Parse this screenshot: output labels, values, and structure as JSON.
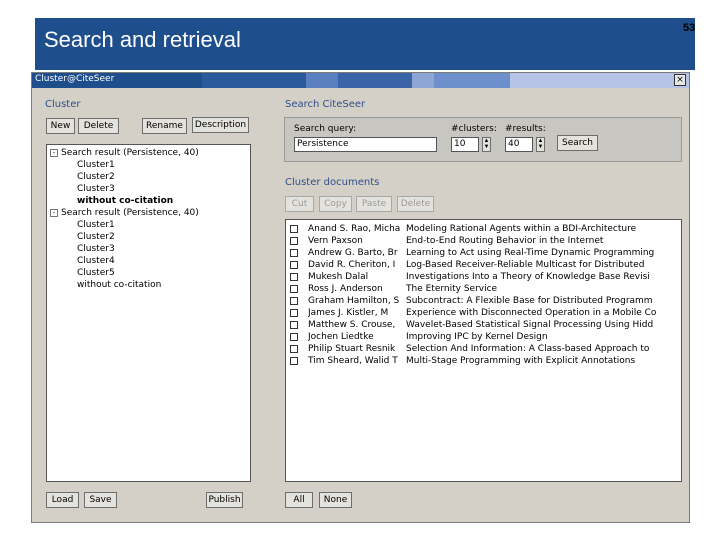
{
  "slide": {
    "title": "Search and retrieval",
    "number": "53"
  },
  "window": {
    "title": "Cluster@CiteSeer",
    "close_label": "×",
    "titlebar_colors": [
      "#1f4e8c",
      "#2a5a9c",
      "#5a7fbf",
      "#3b64a8",
      "#8da6d4",
      "#6d8fcc",
      "#b4c3e6"
    ]
  },
  "cluster_panel": {
    "title": "Cluster",
    "buttons": {
      "new": "New",
      "delete": "Delete",
      "rename": "Rename",
      "description": "Description"
    },
    "tree": [
      {
        "level": 0,
        "toggle": "-",
        "label": "Search result (Persistence, 40)"
      },
      {
        "level": 1,
        "label": "Cluster1"
      },
      {
        "level": 1,
        "label": "Cluster2"
      },
      {
        "level": 1,
        "label": "Cluster3"
      },
      {
        "level": 1,
        "label": "without co-citation",
        "bold": true
      },
      {
        "level": 0,
        "toggle": "-",
        "label": "Search result (Persistence, 40)"
      },
      {
        "level": 1,
        "label": "Cluster1"
      },
      {
        "level": 1,
        "label": "Cluster2"
      },
      {
        "level": 1,
        "label": "Cluster3"
      },
      {
        "level": 1,
        "label": "Cluster4"
      },
      {
        "level": 1,
        "label": "Cluster5"
      },
      {
        "level": 1,
        "label": "without co-citation"
      }
    ],
    "bottom_buttons": {
      "load": "Load",
      "save": "Save",
      "publish": "Publish"
    }
  },
  "search_panel": {
    "title": "Search CiteSeer",
    "query_label": "Search query:",
    "query_value": "Persistence",
    "clusters_label": "#clusters:",
    "clusters_value": "10",
    "results_label": "#results:",
    "results_value": "40",
    "search_button": "Search"
  },
  "documents_panel": {
    "title": "Cluster documents",
    "buttons": {
      "cut": "Cut",
      "copy": "Copy",
      "paste": "Paste",
      "delete": "Delete"
    },
    "rows": [
      {
        "author": "Anand S. Rao, Micha",
        "title": "Modeling Rational Agents within a BDI-Architecture"
      },
      {
        "author": "Vern Paxson",
        "title": "End-to-End Routing Behavior in the Internet"
      },
      {
        "author": "Andrew G. Barto, Br",
        "title": "Learning to Act using Real-Time Dynamic Programming"
      },
      {
        "author": "David R. Cheriton, I",
        "title": "Log-Based Receiver-Reliable Multicast for Distributed"
      },
      {
        "author": "Mukesh Dalal",
        "title": "Investigations Into a Theory of Knowledge Base Revisi"
      },
      {
        "author": "Ross J. Anderson",
        "title": "The Eternity Service"
      },
      {
        "author": "Graham Hamilton, S",
        "title": "Subcontract: A Flexible Base for Distributed Programm"
      },
      {
        "author": "James J. Kistler, M",
        "title": "Experience with Disconnected Operation in a Mobile Co"
      },
      {
        "author": "Matthew S. Crouse,",
        "title": "Wavelet-Based Statistical Signal Processing Using Hidd"
      },
      {
        "author": "Jochen Liedtke",
        "title": "Improving IPC by Kernel Design"
      },
      {
        "author": "Philip Stuart Resnik",
        "title": "Selection And Information: A Class-based Approach to"
      },
      {
        "author": "Tim Sheard, Walid T",
        "title": "Multi-Stage Programming with Explicit Annotations"
      }
    ],
    "bottom_buttons": {
      "all": "All",
      "none": "None"
    }
  }
}
